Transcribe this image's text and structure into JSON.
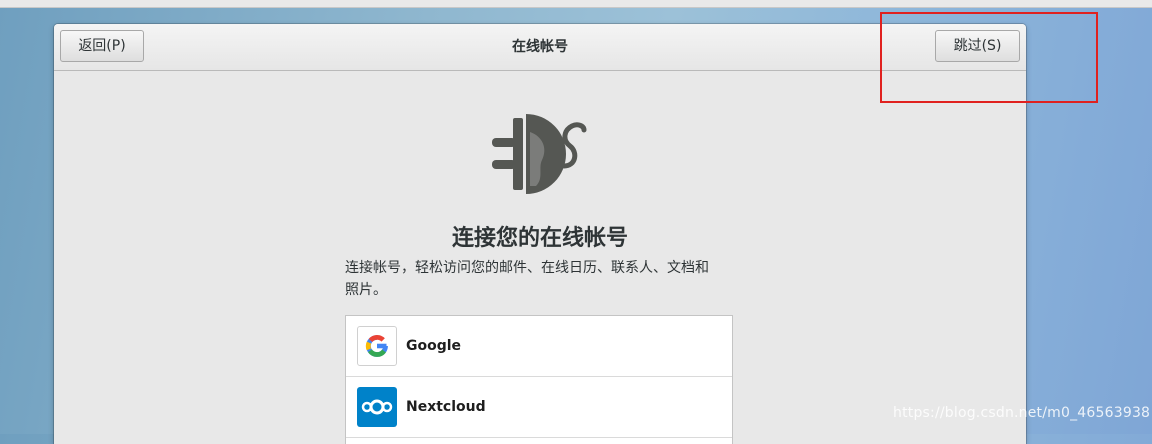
{
  "header": {
    "back_label": "返回(P)",
    "title": "在线帐号",
    "skip_label": "跳过(S)"
  },
  "main": {
    "heading": "连接您的在线帐号",
    "description_line1": "连接帐号，轻松访问您的邮件、在线日历、联系人、文档和",
    "description_line2": "照片。"
  },
  "providers": [
    {
      "name": "Google",
      "icon": "google-icon"
    },
    {
      "name": "Nextcloud",
      "icon": "nextcloud-icon"
    }
  ],
  "watermark": "https://blog.csdn.net/m0_46563938",
  "colors": {
    "highlight": "#e0211f",
    "nextcloud_blue": "#0082c9"
  }
}
